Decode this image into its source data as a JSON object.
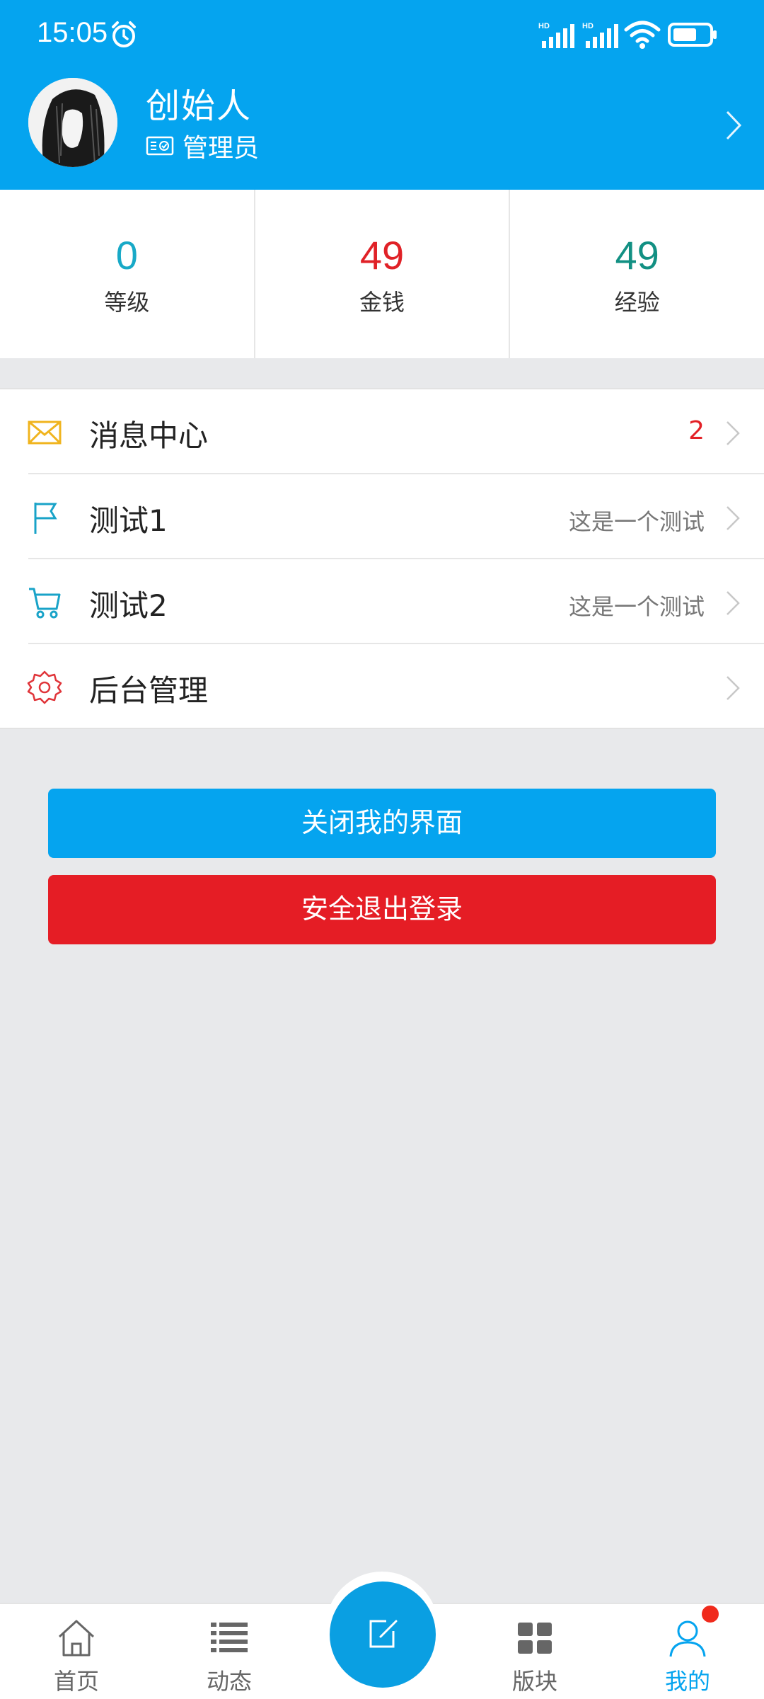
{
  "status_bar": {
    "time": "15:05",
    "network_1": "HD",
    "network_2": "HD"
  },
  "profile": {
    "name": "创始人",
    "role": "管理员"
  },
  "stats": [
    {
      "value": "0",
      "label": "等级",
      "color": "#18a9c7"
    },
    {
      "value": "49",
      "label": "金钱",
      "color": "#e02127"
    },
    {
      "value": "49",
      "label": "经验",
      "color": "#129083"
    }
  ],
  "menu": [
    {
      "label": "消息中心",
      "badge": "2",
      "icon": "mail-icon"
    },
    {
      "label": "测试1",
      "value": "这是一个测试",
      "icon": "flag-icon"
    },
    {
      "label": "测试2",
      "value": "这是一个测试",
      "icon": "cart-icon"
    },
    {
      "label": "后台管理",
      "icon": "settings-gear-icon"
    }
  ],
  "buttons": {
    "close": "关闭我的界面",
    "logout": "安全退出登录"
  },
  "tabs": [
    {
      "label": "首页",
      "icon": "home-icon"
    },
    {
      "label": "动态",
      "icon": "list-icon"
    },
    {
      "label": "版块",
      "icon": "grid-icon"
    },
    {
      "label": "我的",
      "icon": "user-icon",
      "active": true
    }
  ],
  "colors": {
    "accent": "#05a4ef",
    "danger": "#e51d25"
  }
}
